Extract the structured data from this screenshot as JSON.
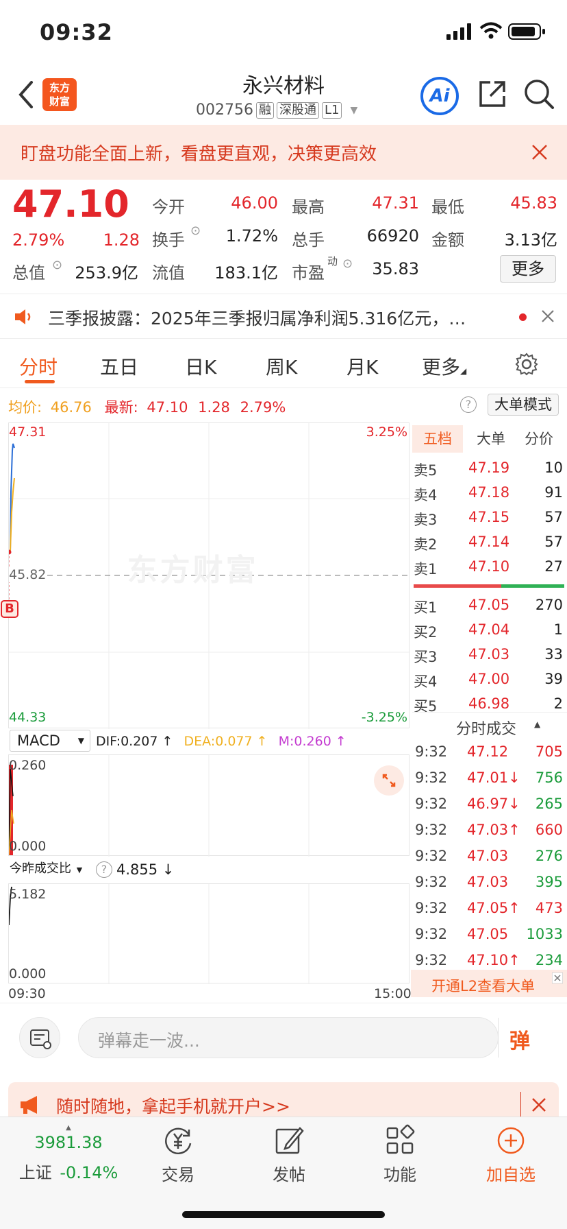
{
  "status_bar": {
    "time": "09:32"
  },
  "header": {
    "logo_line1": "东方",
    "logo_line2": "财富",
    "name": "永兴材料",
    "code": "002756",
    "tags": [
      "融",
      "深股通",
      "L1"
    ],
    "ai_label": "Ai"
  },
  "banner": {
    "text": "盯盘功能全面上新，看盘更直观，决策更高效"
  },
  "quote": {
    "price": "47.10",
    "change_pct": "2.79%",
    "change": "1.28",
    "open_label": "今开",
    "open": "46.00",
    "high_label": "最高",
    "high": "47.31",
    "low_label": "最低",
    "low": "45.83",
    "turnover_label": "换手",
    "turnover": "1.72%",
    "volume_label": "总手",
    "volume": "66920",
    "amount_label": "金额",
    "amount": "3.13亿",
    "mktcap_label": "总值",
    "mktcap": "253.9亿",
    "float_label": "流值",
    "float": "183.1亿",
    "pe_label": "市盈",
    "pe_sup": "动",
    "pe": "35.83",
    "more": "更多"
  },
  "ticker": {
    "text": "三季报披露：2025年三季报归属净利润5.316亿元，…"
  },
  "tabs": [
    "分时",
    "五日",
    "日K",
    "周K",
    "月K",
    "更多"
  ],
  "chart_info": {
    "avg_label": "均价:",
    "avg": "46.76",
    "latest_label": "最新:",
    "latest": "47.10",
    "latest_change": "1.28",
    "latest_pct": "2.79%",
    "big_mode": "大单模式"
  },
  "chart": {
    "top_price": "47.31",
    "top_pct": "3.25%",
    "mid_price": "45.82",
    "bottom_price": "44.33",
    "bottom_pct": "-3.25%",
    "watermark": "东方财富",
    "b_marker": "B",
    "macd_select": "MACD",
    "dif": "DIF:0.207 ↑",
    "dea": "DEA:0.077 ↑",
    "m": "M:0.260 ↑",
    "macd_top": "0.260",
    "macd_bottom": "0.000",
    "vol_ratio_select": "今昨成交比",
    "vol_ratio": "4.855 ↓",
    "vol_top": "5.182",
    "vol_bottom": "0.000",
    "time_start": "09:30",
    "time_end": "15:00"
  },
  "orderbook": {
    "tabs": [
      "五档",
      "大单",
      "分价"
    ],
    "asks": [
      {
        "label": "卖5",
        "price": "47.19",
        "qty": "10"
      },
      {
        "label": "卖4",
        "price": "47.18",
        "qty": "91"
      },
      {
        "label": "卖3",
        "price": "47.15",
        "qty": "57"
      },
      {
        "label": "卖2",
        "price": "47.14",
        "qty": "57"
      },
      {
        "label": "卖1",
        "price": "47.10",
        "qty": "27"
      }
    ],
    "bids": [
      {
        "label": "买1",
        "price": "47.05",
        "qty": "270"
      },
      {
        "label": "买2",
        "price": "47.04",
        "qty": "1"
      },
      {
        "label": "买3",
        "price": "47.03",
        "qty": "33"
      },
      {
        "label": "买4",
        "price": "47.00",
        "qty": "39"
      },
      {
        "label": "买5",
        "price": "46.98",
        "qty": "2"
      }
    ],
    "trades_title": "分时成交",
    "trades": [
      {
        "time": "9:32",
        "price": "47.12",
        "qty": "705",
        "color": "red"
      },
      {
        "time": "9:32",
        "price": "47.01↓",
        "qty": "756",
        "color": "green"
      },
      {
        "time": "9:32",
        "price": "46.97↓",
        "qty": "265",
        "color": "green"
      },
      {
        "time": "9:32",
        "price": "47.03↑",
        "qty": "660",
        "color": "red"
      },
      {
        "time": "9:32",
        "price": "47.03",
        "qty": "276",
        "color": "green"
      },
      {
        "time": "9:32",
        "price": "47.03",
        "qty": "395",
        "color": "green"
      },
      {
        "time": "9:32",
        "price": "47.05↑",
        "qty": "473",
        "color": "red"
      },
      {
        "time": "9:32",
        "price": "47.05",
        "qty": "1033",
        "color": "green"
      },
      {
        "time": "9:32",
        "price": "47.10↑",
        "qty": "234",
        "color": "green"
      }
    ],
    "l2_promo": "开通L2查看大单"
  },
  "danmu": {
    "placeholder": "弹幕走一波...",
    "send": "弹"
  },
  "promo": {
    "text": "随时随地，拿起手机就开户>>"
  },
  "bottom_nav": {
    "index_value": "3981.38",
    "index_name": "上证",
    "index_change": "-0.14%",
    "items": [
      "交易",
      "发帖",
      "功能",
      "加自选"
    ]
  }
}
